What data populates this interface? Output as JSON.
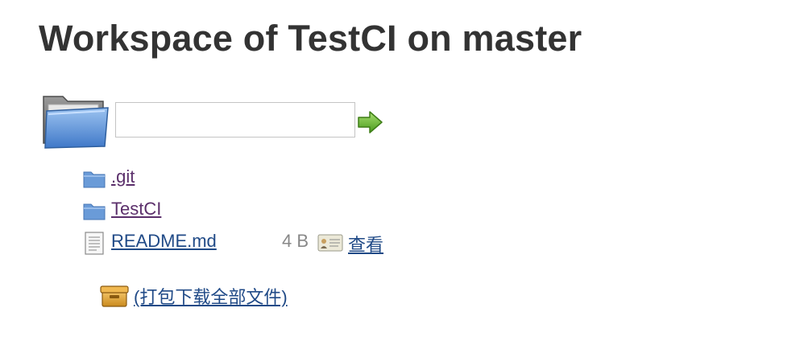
{
  "header": {
    "title": "Workspace of TestCI on master"
  },
  "path_bar": {
    "folder_icon": "folder-open-icon",
    "input_value": "",
    "input_placeholder": "",
    "go_icon": "green-arrow-right-icon"
  },
  "files": [
    {
      "name": ".git",
      "type": "directory",
      "icon": "folder-icon"
    },
    {
      "name": "TestCI",
      "type": "directory",
      "icon": "folder-icon"
    },
    {
      "name": "README.md",
      "type": "file",
      "icon": "text-file-icon",
      "size": "4 B",
      "view_icon": "view-file-icon",
      "view_label": "查看"
    }
  ],
  "zip": {
    "icon": "archive-box-icon",
    "label": "(打包下载全部文件)"
  },
  "colors": {
    "title": "#333333",
    "directory_link": "#5b2f6b",
    "file_link": "#204a87",
    "size_text": "#888888",
    "folder_blue": "#6a9bd8",
    "arrow_green": "#5aa82a"
  }
}
